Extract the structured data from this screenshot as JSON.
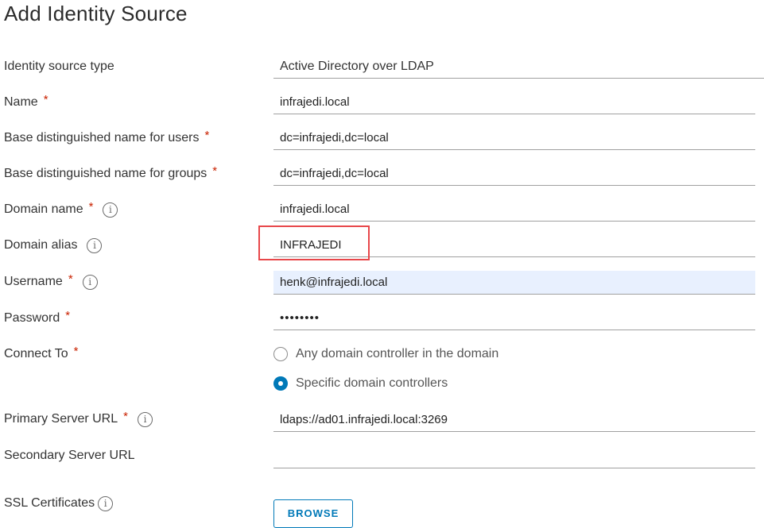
{
  "dialog": {
    "title": "Add Identity Source"
  },
  "form": {
    "required_marker": "*",
    "info_icon_glyph": "i",
    "identity_source_type": {
      "label": "Identity source type",
      "value": "Active Directory over LDAP"
    },
    "name": {
      "label": "Name",
      "value": "infrajedi.local"
    },
    "base_dn_users": {
      "label": "Base distinguished name for users",
      "value": "dc=infrajedi,dc=local"
    },
    "base_dn_groups": {
      "label": "Base distinguished name for groups",
      "value": "dc=infrajedi,dc=local"
    },
    "domain_name": {
      "label": "Domain name",
      "value": "infrajedi.local"
    },
    "domain_alias": {
      "label": "Domain alias",
      "value": "INFRAJEDI"
    },
    "username": {
      "label": "Username",
      "value": "henk@infrajedi.local"
    },
    "password": {
      "label": "Password",
      "value": "••••••••"
    },
    "connect_to": {
      "label": "Connect To",
      "options": [
        {
          "label": "Any domain controller in the domain",
          "checked": false
        },
        {
          "label": "Specific domain controllers",
          "checked": true
        }
      ]
    },
    "primary_server_url": {
      "label": "Primary Server URL",
      "value": "ldaps://ad01.infrajedi.local:3269"
    },
    "secondary_server_url": {
      "label": "Secondary Server URL",
      "value": ""
    },
    "ssl_certificates": {
      "label": "SSL Certificates",
      "browse_label": "BROWSE"
    }
  },
  "colors": {
    "required": "#c92100",
    "accent": "#0079b8",
    "highlight_box": "#e8474a",
    "autofill_bg": "#e8f0fe"
  }
}
